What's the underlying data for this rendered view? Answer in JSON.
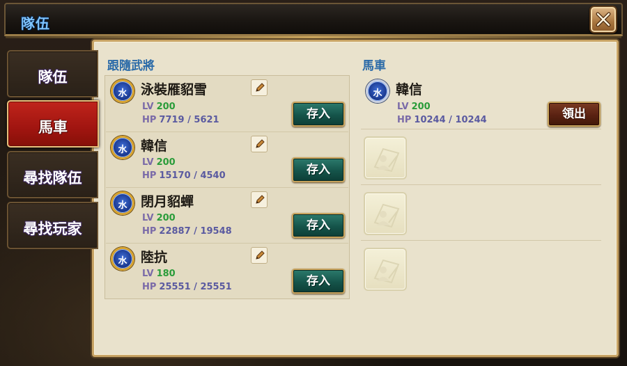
{
  "window": {
    "title": "隊伍"
  },
  "tabs": [
    {
      "label": "隊伍",
      "active": false
    },
    {
      "label": "馬車",
      "active": true
    },
    {
      "label": "尋找隊伍",
      "active": false
    },
    {
      "label": "尋找玩家",
      "active": false
    }
  ],
  "followers": {
    "title": "跟隨武將",
    "items": [
      {
        "element": "水",
        "name": "泳裝雁貂雪",
        "lv_label": "LV",
        "lv": "200",
        "hp_label": "HP",
        "hp": "7719 / 5621",
        "button": "存入"
      },
      {
        "element": "水",
        "name": "韓信",
        "lv_label": "LV",
        "lv": "200",
        "hp_label": "HP",
        "hp": "15170 / 4540",
        "button": "存入"
      },
      {
        "element": "水",
        "name": "閉月貂蟬",
        "lv_label": "LV",
        "lv": "200",
        "hp_label": "HP",
        "hp": "22887 / 19548",
        "button": "存入"
      },
      {
        "element": "水",
        "name": "陸抗",
        "lv_label": "LV",
        "lv": "180",
        "hp_label": "HP",
        "hp": "25551 / 25551",
        "button": "存入"
      }
    ]
  },
  "carriage": {
    "title": "馬車",
    "stored": {
      "element": "水",
      "name": "韓信",
      "lv_label": "LV",
      "lv": "200",
      "hp_label": "HP",
      "hp": "10244 / 10244",
      "button": "領出"
    },
    "empty_slots": 3
  },
  "colors": {
    "active_tab": "#a01510",
    "deposit_button": "#15544a",
    "withdraw_button": "#5a2212",
    "section_title": "#2a6aa8"
  },
  "icons": [
    "close-icon",
    "water-element-icon",
    "edit-pencil-icon",
    "empty-character-slot-icon"
  ]
}
